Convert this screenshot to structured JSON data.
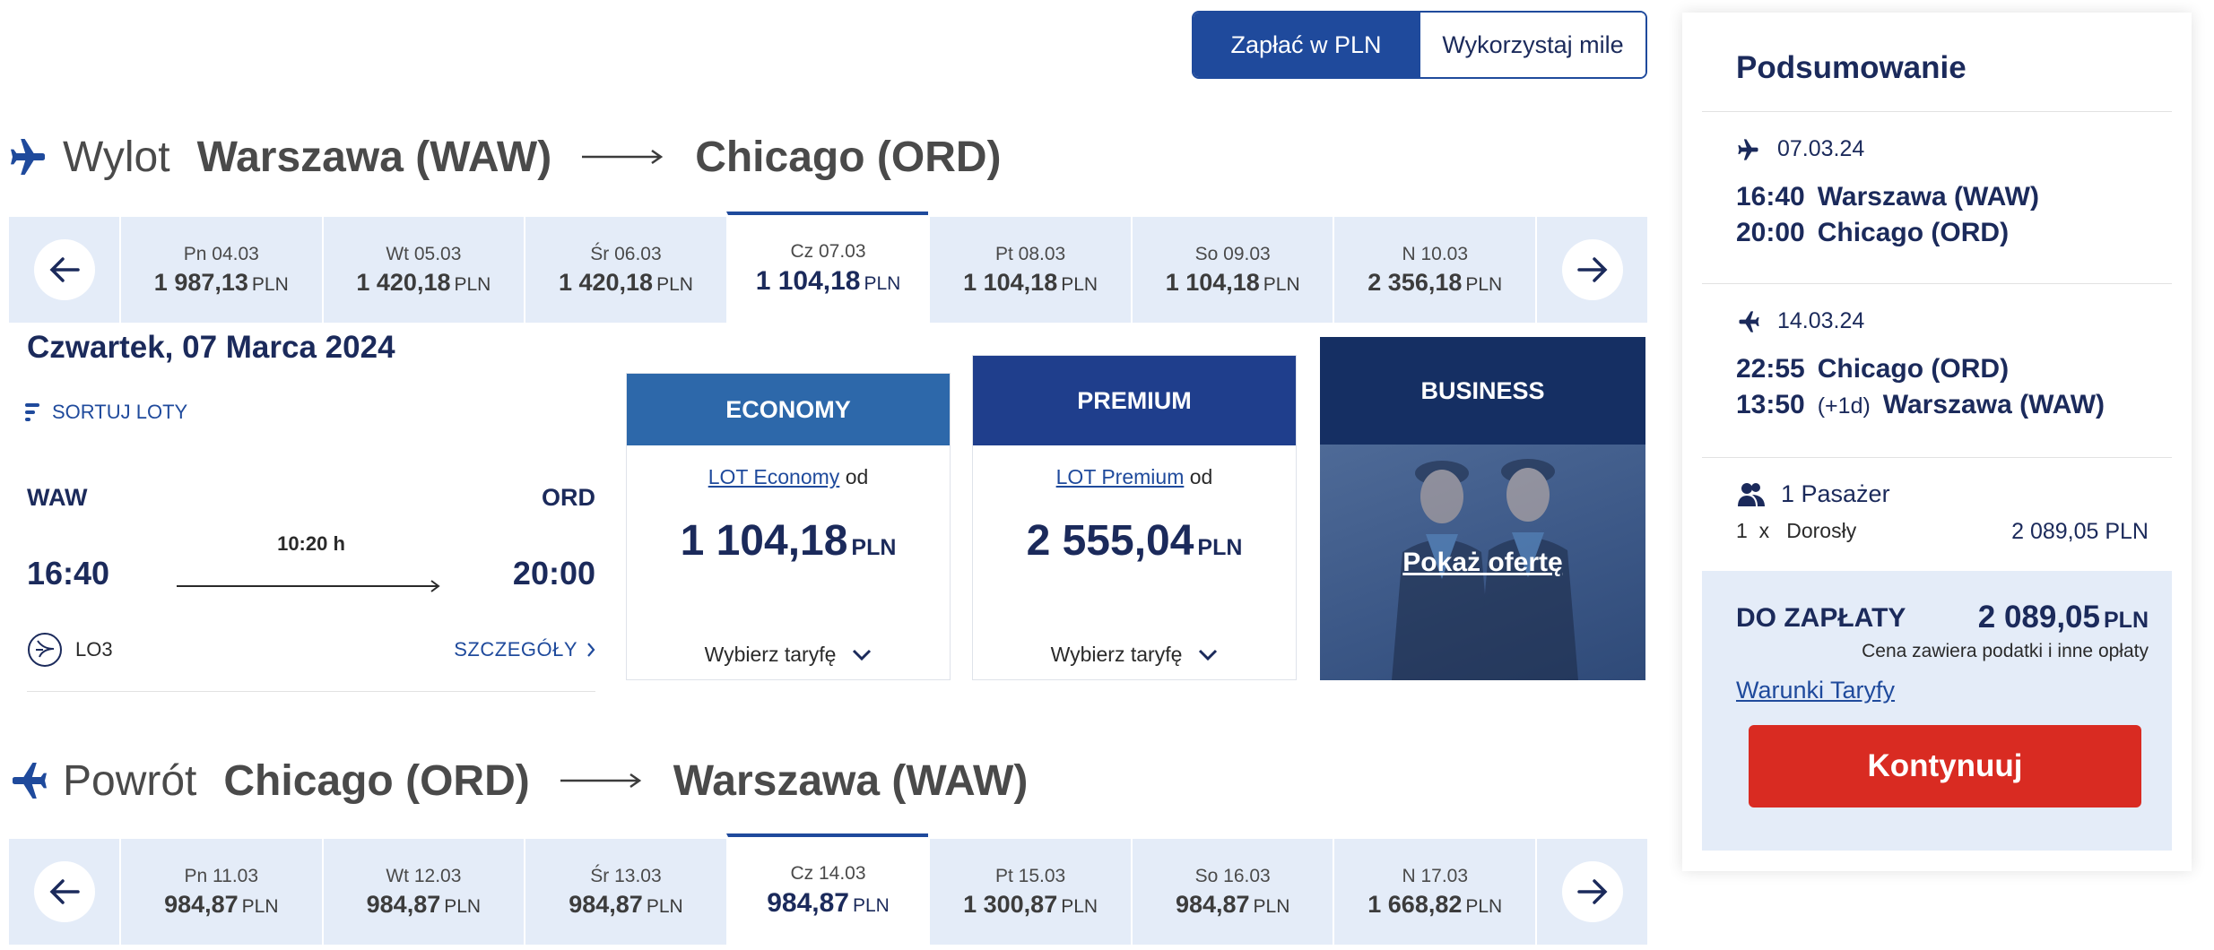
{
  "pay_toggle": {
    "pln": "Zapłać w PLN",
    "miles": "Wykorzystaj mile"
  },
  "outbound": {
    "word": "Wylot",
    "from": "Warszawa (WAW)",
    "to": "Chicago (ORD)",
    "days": [
      {
        "label": "Pn 04.03",
        "price": "1 987,13",
        "cur": "PLN"
      },
      {
        "label": "Wt 05.03",
        "price": "1 420,18",
        "cur": "PLN"
      },
      {
        "label": "Śr 06.03",
        "price": "1 420,18",
        "cur": "PLN"
      },
      {
        "label": "Cz 07.03",
        "price": "1 104,18",
        "cur": "PLN"
      },
      {
        "label": "Pt 08.03",
        "price": "1 104,18",
        "cur": "PLN"
      },
      {
        "label": "So 09.03",
        "price": "1 104,18",
        "cur": "PLN"
      },
      {
        "label": "N 10.03",
        "price": "2 356,18",
        "cur": "PLN"
      }
    ],
    "selected_day": "Cz 07.03",
    "date_heading": "Czwartek, 07 Marca 2024",
    "sort_label": "SORTUJ LOTY",
    "flight": {
      "from_code": "WAW",
      "to_code": "ORD",
      "dep": "16:40",
      "arr": "20:00",
      "duration": "10:20 h",
      "flight_no": "LO3",
      "details": "SZCZEGÓŁY"
    }
  },
  "fares": {
    "economy": {
      "head": "ECONOMY",
      "link": "LOT Economy",
      "od": "od",
      "price": "1 104,18",
      "cur": "PLN",
      "choose": "Wybierz taryfę",
      "color": "#2d68aa"
    },
    "premium": {
      "head": "PREMIUM",
      "link": "LOT Premium",
      "od": "od",
      "price": "2 555,04",
      "cur": "PLN",
      "choose": "Wybierz taryfę",
      "color": "#1f3e8c"
    },
    "business": {
      "head": "BUSINESS",
      "offer": "Pokaż ofertę",
      "color": "#152f63"
    }
  },
  "inbound": {
    "word": "Powrót",
    "from": "Chicago (ORD)",
    "to": "Warszawa (WAW)",
    "days": [
      {
        "label": "Pn 11.03",
        "price": "984,87",
        "cur": "PLN"
      },
      {
        "label": "Wt 12.03",
        "price": "984,87",
        "cur": "PLN"
      },
      {
        "label": "Śr 13.03",
        "price": "984,87",
        "cur": "PLN"
      },
      {
        "label": "Cz 14.03",
        "price": "984,87",
        "cur": "PLN"
      },
      {
        "label": "Pt 15.03",
        "price": "1 300,87",
        "cur": "PLN"
      },
      {
        "label": "So 16.03",
        "price": "984,87",
        "cur": "PLN"
      },
      {
        "label": "N 17.03",
        "price": "1 668,82",
        "cur": "PLN"
      }
    ],
    "selected_day": "Cz 14.03"
  },
  "summary": {
    "title": "Podsumowanie",
    "leg1": {
      "date": "07.03.24",
      "dep_time": "16:40",
      "dep_city": "Warszawa (WAW)",
      "arr_time": "20:00",
      "arr_city": "Chicago (ORD)"
    },
    "leg2": {
      "date": "14.03.24",
      "dep_time": "22:55",
      "dep_city": "Chicago (ORD)",
      "arr_time": "13:50",
      "arr_plus": "(+1d)",
      "arr_city": "Warszawa (WAW)"
    },
    "passengers": {
      "title": "1 Pasażer",
      "count": "1",
      "x": "x",
      "type": "Dorosły",
      "price": "2 089,05 PLN"
    },
    "pay": {
      "label": "DO ZAPŁATY",
      "total": "2 089,05",
      "cur": "PLN",
      "note": "Cena zawiera podatki i inne opłaty",
      "terms": "Warunki Taryfy",
      "cta": "Kontynuuj"
    }
  },
  "colors": {
    "brand": "#1f4a9c",
    "navy": "#1b2a5b",
    "strip": "#e4ecf8",
    "cta": "#d92b22"
  }
}
